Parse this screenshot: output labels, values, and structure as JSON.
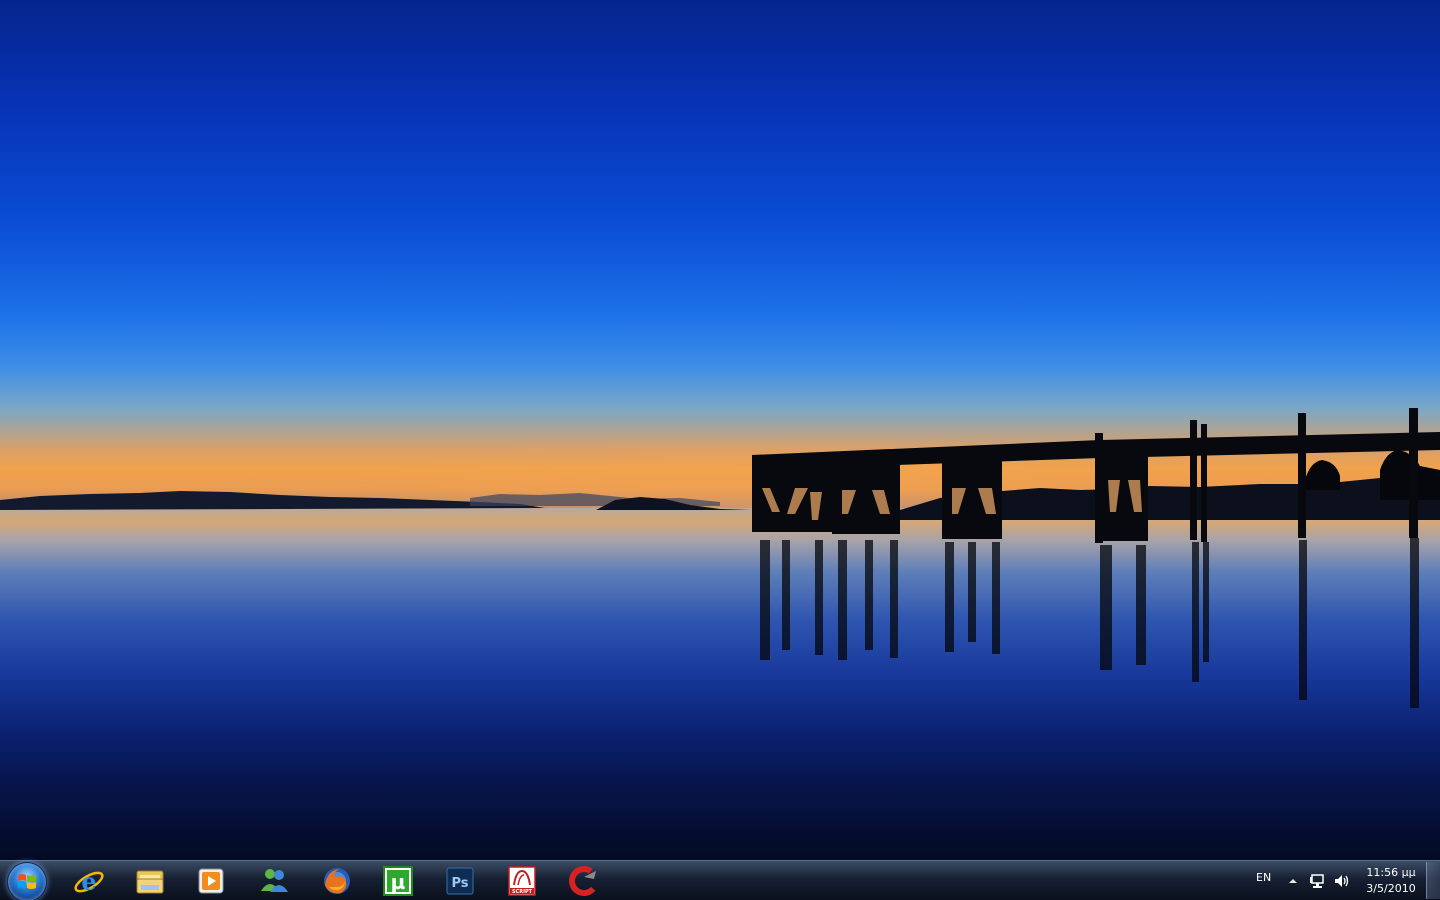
{
  "taskbar": {
    "start_button": {
      "icon": "windows-flag-icon"
    },
    "pinned": [
      {
        "name": "internet-explorer",
        "icon": "ie-icon"
      },
      {
        "name": "windows-explorer",
        "icon": "folder-icon"
      },
      {
        "name": "media-player",
        "icon": "media-player-icon"
      },
      {
        "name": "windows-live-messenger",
        "icon": "messenger-icon"
      },
      {
        "name": "firefox",
        "icon": "firefox-icon"
      },
      {
        "name": "utorrent",
        "icon": "utorrent-icon"
      },
      {
        "name": "photoshop",
        "icon": "photoshop-icon"
      },
      {
        "name": "script-app",
        "icon": "script-icon"
      },
      {
        "name": "ccleaner",
        "icon": "ccleaner-icon"
      }
    ],
    "photoshop_label": "Ps",
    "utorrent_label": "µ",
    "script_label": "SCRIPT",
    "tray": {
      "language": "EN",
      "time": "11:56 μμ",
      "date": "3/5/2010"
    }
  }
}
